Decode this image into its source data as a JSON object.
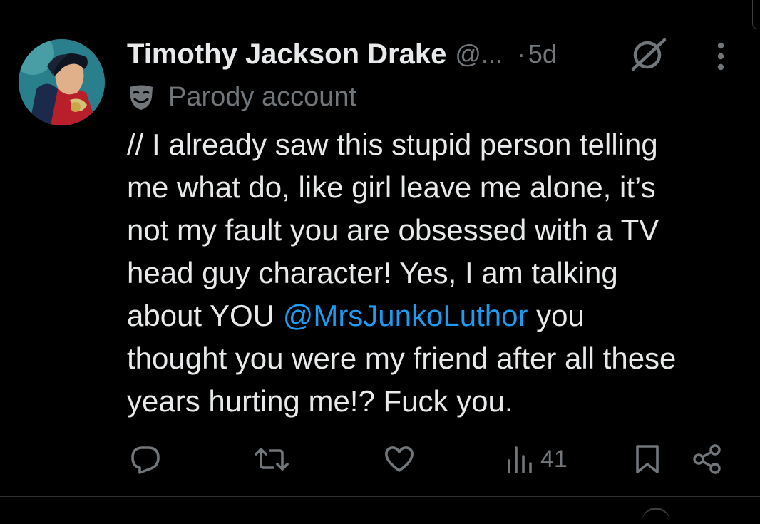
{
  "tweet": {
    "display_name": "Timothy Jackson Drake",
    "handle": "@...",
    "separator": "·",
    "time": "5d",
    "parody_label": "Parody account",
    "text_lines": [
      "// I already saw this stupid person telling",
      "me what do, like girl leave me alone, it’s",
      "not my fault you are obsessed with a TV",
      "head guy character! Yes, I am talking"
    ],
    "text_before_mention": "about YOU ",
    "mention": "@MrsJunkoLuthor",
    "text_after_mention": " you",
    "text_tail_lines": [
      "thought you were my friend after all these",
      "years hurting me!? Fuck you."
    ]
  },
  "actions": {
    "views_count": "41"
  },
  "icons": {
    "avatar": "avatar-comic-character",
    "grok": "grok-icon",
    "more": "more-vertical-icon",
    "parody": "parody-mask-icon",
    "reply": "reply-icon",
    "retweet": "retweet-icon",
    "like": "like-icon",
    "views": "views-icon",
    "bookmark": "bookmark-icon",
    "share": "share-icon"
  },
  "colors": {
    "background": "#000000",
    "text": "#e7e9ea",
    "secondary": "#71767b",
    "mention": "#1d9bf0",
    "divider": "#2f3336"
  }
}
